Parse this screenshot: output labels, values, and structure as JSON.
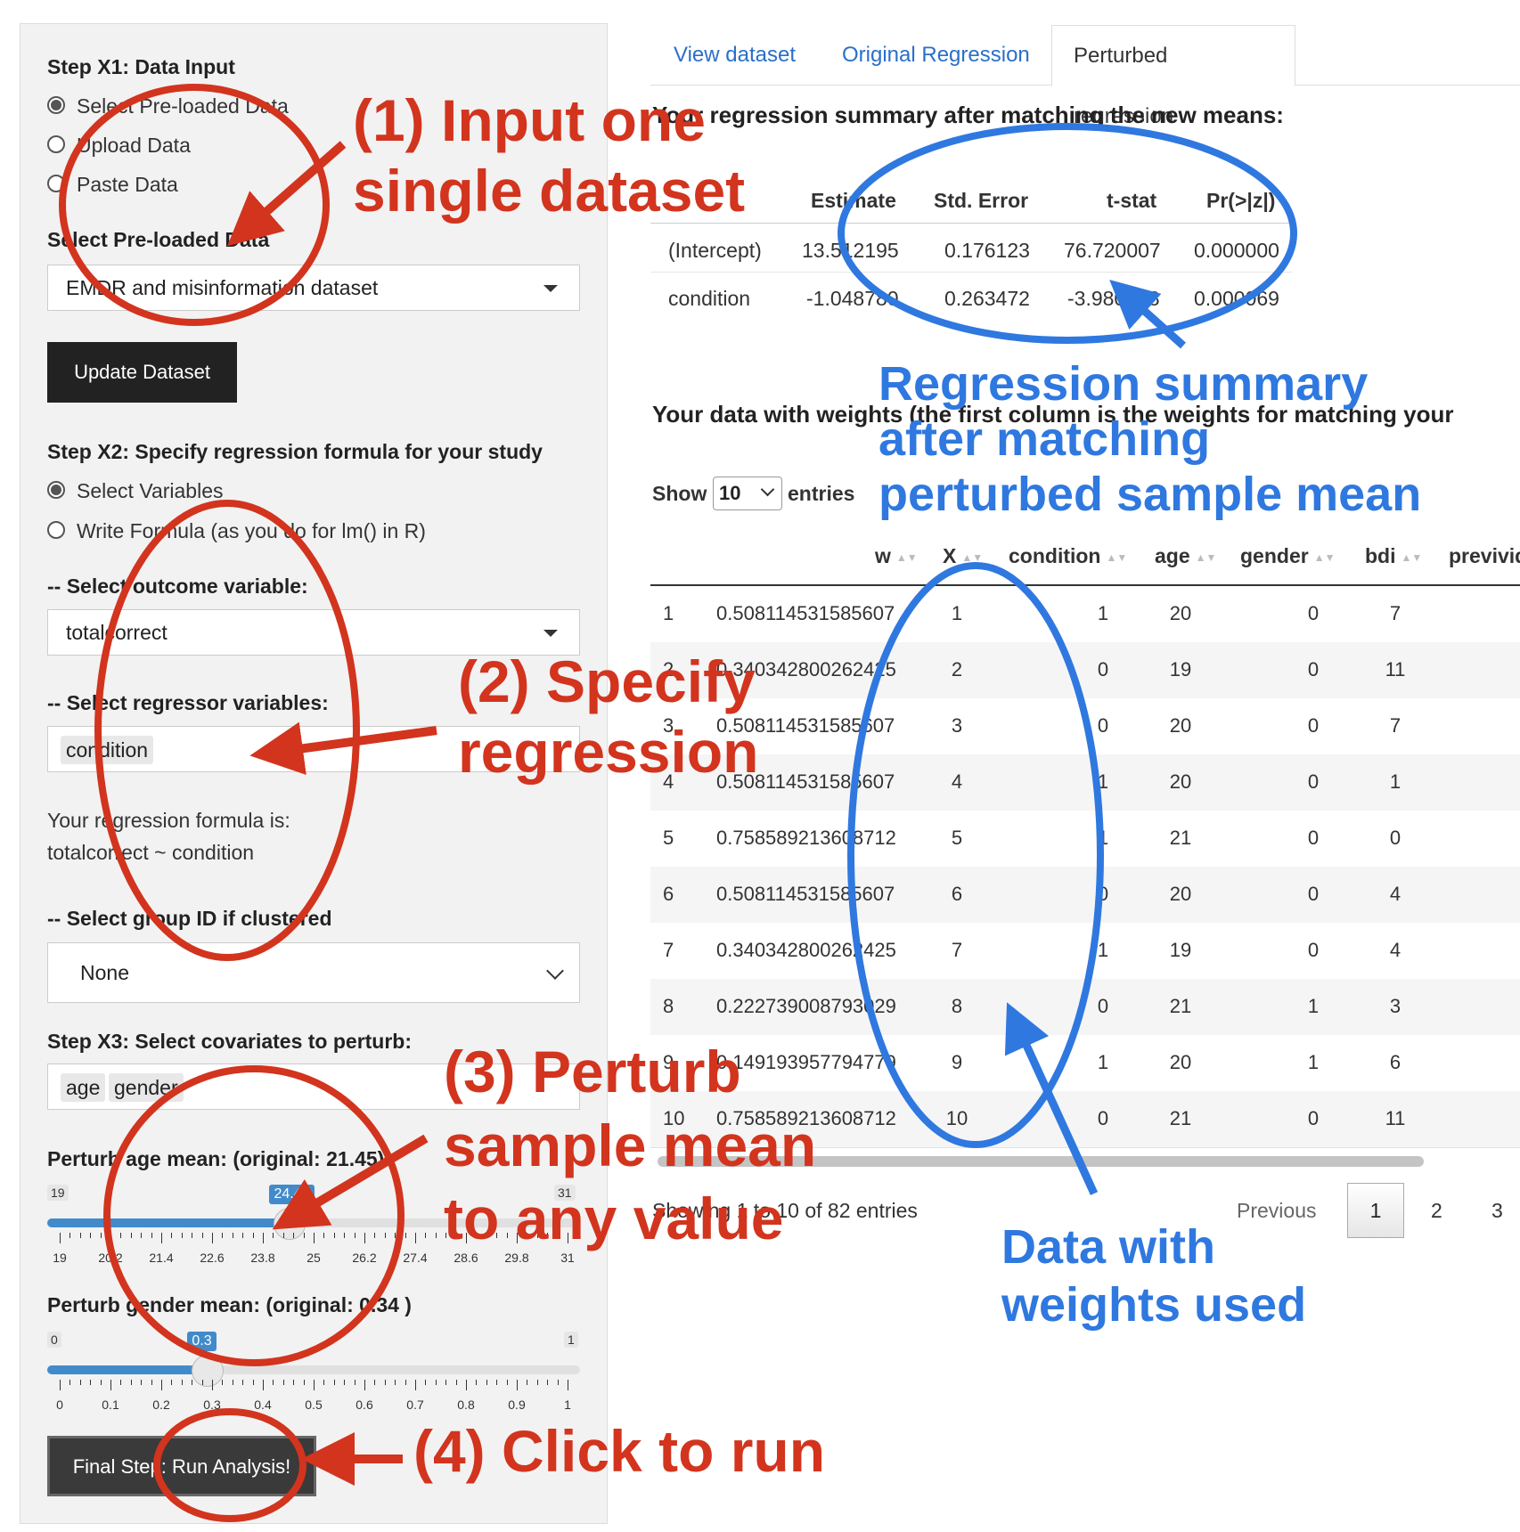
{
  "sidebar": {
    "step1_title": "Step X1: Data Input",
    "radio_options": [
      "Select Pre-loaded Data",
      "Upload Data",
      "Paste Data"
    ],
    "preloaded_label": "Select Pre-loaded Data",
    "preloaded_value": "EMDR and misinformation dataset",
    "update_button": "Update Dataset",
    "step2_title": "Step X2: Specify regression formula for your study",
    "formula_options": [
      "Select Variables",
      "Write Formula (as you do for lm() in R)"
    ],
    "outcome_label": "-- Select outcome variable:",
    "outcome_value": "totalcorrect",
    "regressor_label": "-- Select regressor variables:",
    "regressor_tag": "condition",
    "formula_line1": "Your regression formula is:",
    "formula_line2": "totalcorrect ~ condition",
    "group_label": "-- Select group ID if clustered",
    "group_value": "None",
    "step3_title": "Step X3: Select covariates to perturb:",
    "covariate_tags": [
      "age",
      "gender"
    ],
    "age_slider": {
      "label": "Perturb age mean: (original: 21.45)",
      "min": "19",
      "max": "31",
      "value": "24.45",
      "fraction": 0.454,
      "ticks": [
        "19",
        "20.2",
        "21.4",
        "22.6",
        "23.8",
        "25",
        "26.2",
        "27.4",
        "28.6",
        "29.8",
        "31"
      ]
    },
    "gender_slider": {
      "label": "Perturb gender mean: (original: 0.34 )",
      "min": "0",
      "max": "1",
      "value": "0.3",
      "fraction": 0.3,
      "ticks": [
        "0",
        "0.1",
        "0.2",
        "0.3",
        "0.4",
        "0.5",
        "0.6",
        "0.7",
        "0.8",
        "0.9",
        "1"
      ]
    },
    "run_button": "Final Step: Run Analysis!"
  },
  "tabs": [
    "View dataset",
    "Original Regression",
    "Perturbed regression"
  ],
  "summary": {
    "heading": "Your regression summary after matching the new means:",
    "columns": [
      "",
      "Estimate",
      "Std. Error",
      "t-stat",
      "Pr(>|z|)"
    ],
    "rows": [
      [
        "(Intercept)",
        "13.512195",
        "0.176123",
        "76.720007",
        "0.000000"
      ],
      [
        "condition",
        "-1.048780",
        "0.263472",
        "-3.980628",
        "0.000069"
      ]
    ]
  },
  "weights": {
    "heading": "Your data with weights (the first column is the weights for matching your",
    "show_label": "Show",
    "show_value": "10",
    "entries_label": "entries",
    "columns": [
      "",
      "w",
      "X",
      "condition",
      "age",
      "gender",
      "bdi",
      "previvid"
    ],
    "rows": [
      [
        "1",
        "0.508114531585607",
        "1",
        "1",
        "20",
        "0",
        "7"
      ],
      [
        "2",
        "0.340342800262425",
        "2",
        "0",
        "19",
        "0",
        "11"
      ],
      [
        "3",
        "0.508114531585607",
        "3",
        "0",
        "20",
        "0",
        "7"
      ],
      [
        "4",
        "0.508114531585607",
        "4",
        "1",
        "20",
        "0",
        "1"
      ],
      [
        "5",
        "0.758589213608712",
        "5",
        "1",
        "21",
        "0",
        "0"
      ],
      [
        "6",
        "0.508114531585607",
        "6",
        "0",
        "20",
        "0",
        "4"
      ],
      [
        "7",
        "0.340342800262425",
        "7",
        "1",
        "19",
        "0",
        "4"
      ],
      [
        "8",
        "0.222739008793029",
        "8",
        "0",
        "21",
        "1",
        "3"
      ],
      [
        "9",
        "0.149193957794779",
        "9",
        "1",
        "20",
        "1",
        "6"
      ],
      [
        "10",
        "0.758589213608712",
        "10",
        "0",
        "21",
        "0",
        "11"
      ]
    ],
    "info": "Showing 1 to 10 of 82 entries",
    "pagination": [
      "Previous",
      "1",
      "2",
      "3"
    ]
  },
  "annotations": {
    "a1": [
      "(1) Input one",
      "single dataset"
    ],
    "a2": [
      "(2) Specify",
      "regression"
    ],
    "a3": [
      "(3) Perturb",
      "sample mean",
      "to any value"
    ],
    "a4": [
      "(4) Click to run"
    ],
    "b1": [
      "Regression summary",
      "after matching",
      "perturbed sample mean"
    ],
    "b2": [
      "Data with",
      "weights used"
    ]
  },
  "colors": {
    "annot_red": "#d2341e",
    "annot_blue": "#2f78e0",
    "slider": "#428bca"
  }
}
